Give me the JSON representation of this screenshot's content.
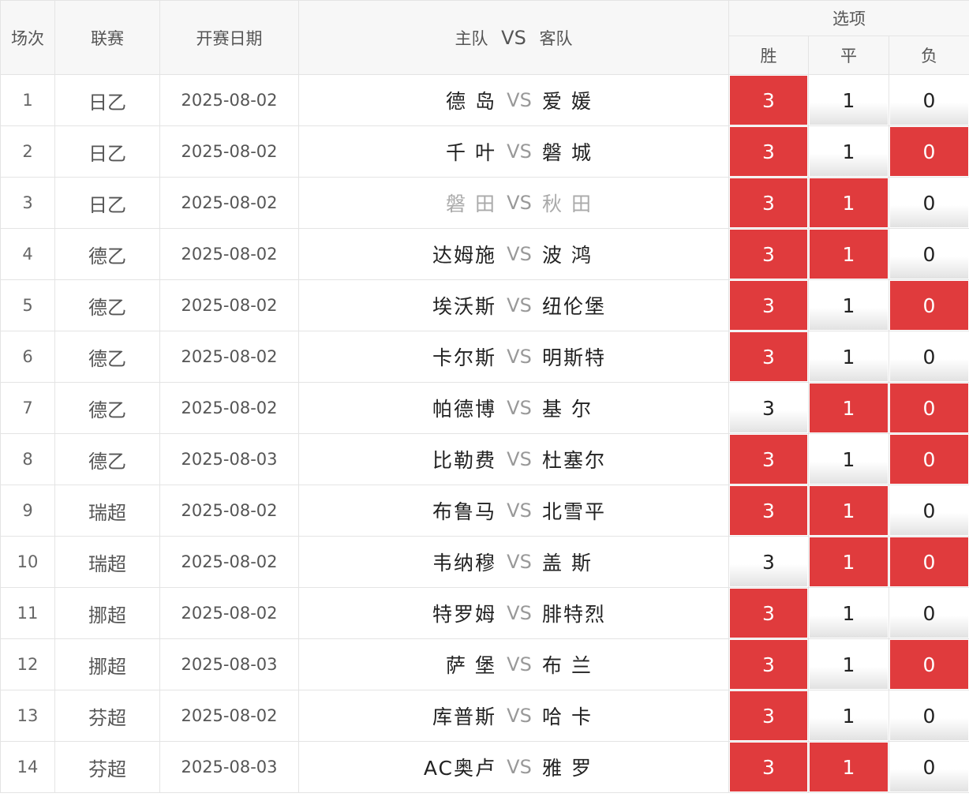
{
  "header": {
    "col_num": "场次",
    "col_league": "联赛",
    "col_date": "开赛日期",
    "col_match_home": "主队",
    "col_match_vs": "VS",
    "col_match_away": "客队",
    "col_options": "选项",
    "opt_win": "胜",
    "opt_draw": "平",
    "opt_lose": "负"
  },
  "colors": {
    "selected": "#e03b3d",
    "unselected": "#ffffff"
  },
  "rows": [
    {
      "num": "1",
      "league": "日乙",
      "date": "2025-08-02",
      "home": "德 岛",
      "vs": "VS",
      "away": "爱 媛",
      "w": "3",
      "d": "1",
      "l": "0",
      "sel": [
        true,
        false,
        false
      ]
    },
    {
      "num": "2",
      "league": "日乙",
      "date": "2025-08-02",
      "home": "千 叶",
      "vs": "VS",
      "away": "磐 城",
      "w": "3",
      "d": "1",
      "l": "0",
      "sel": [
        true,
        false,
        true
      ]
    },
    {
      "num": "3",
      "league": "日乙",
      "date": "2025-08-02",
      "home": "磐 田",
      "vs": "VS",
      "away": "秋 田",
      "w": "3",
      "d": "1",
      "l": "0",
      "sel": [
        true,
        true,
        false
      ],
      "grey": true
    },
    {
      "num": "4",
      "league": "德乙",
      "date": "2025-08-02",
      "home": "达姆施",
      "vs": "VS",
      "away": "波 鸿",
      "w": "3",
      "d": "1",
      "l": "0",
      "sel": [
        true,
        true,
        false
      ]
    },
    {
      "num": "5",
      "league": "德乙",
      "date": "2025-08-02",
      "home": "埃沃斯",
      "vs": "VS",
      "away": "纽伦堡",
      "w": "3",
      "d": "1",
      "l": "0",
      "sel": [
        true,
        false,
        true
      ]
    },
    {
      "num": "6",
      "league": "德乙",
      "date": "2025-08-02",
      "home": "卡尔斯",
      "vs": "VS",
      "away": "明斯特",
      "w": "3",
      "d": "1",
      "l": "0",
      "sel": [
        true,
        false,
        false
      ]
    },
    {
      "num": "7",
      "league": "德乙",
      "date": "2025-08-02",
      "home": "帕德博",
      "vs": "VS",
      "away": "基 尔",
      "w": "3",
      "d": "1",
      "l": "0",
      "sel": [
        false,
        true,
        true
      ]
    },
    {
      "num": "8",
      "league": "德乙",
      "date": "2025-08-03",
      "home": "比勒费",
      "vs": "VS",
      "away": "杜塞尔",
      "w": "3",
      "d": "1",
      "l": "0",
      "sel": [
        true,
        false,
        true
      ]
    },
    {
      "num": "9",
      "league": "瑞超",
      "date": "2025-08-02",
      "home": "布鲁马",
      "vs": "VS",
      "away": "北雪平",
      "w": "3",
      "d": "1",
      "l": "0",
      "sel": [
        true,
        true,
        false
      ]
    },
    {
      "num": "10",
      "league": "瑞超",
      "date": "2025-08-02",
      "home": "韦纳穆",
      "vs": "VS",
      "away": "盖 斯",
      "w": "3",
      "d": "1",
      "l": "0",
      "sel": [
        false,
        true,
        true
      ]
    },
    {
      "num": "11",
      "league": "挪超",
      "date": "2025-08-02",
      "home": "特罗姆",
      "vs": "VS",
      "away": "腓特烈",
      "w": "3",
      "d": "1",
      "l": "0",
      "sel": [
        true,
        false,
        false
      ]
    },
    {
      "num": "12",
      "league": "挪超",
      "date": "2025-08-03",
      "home": "萨 堡",
      "vs": "VS",
      "away": "布 兰",
      "w": "3",
      "d": "1",
      "l": "0",
      "sel": [
        true,
        false,
        true
      ]
    },
    {
      "num": "13",
      "league": "芬超",
      "date": "2025-08-02",
      "home": "库普斯",
      "vs": "VS",
      "away": "哈 卡",
      "w": "3",
      "d": "1",
      "l": "0",
      "sel": [
        true,
        false,
        false
      ]
    },
    {
      "num": "14",
      "league": "芬超",
      "date": "2025-08-03",
      "home": "AC奥卢",
      "vs": "VS",
      "away": "雅 罗",
      "w": "3",
      "d": "1",
      "l": "0",
      "sel": [
        true,
        true,
        false
      ]
    }
  ]
}
